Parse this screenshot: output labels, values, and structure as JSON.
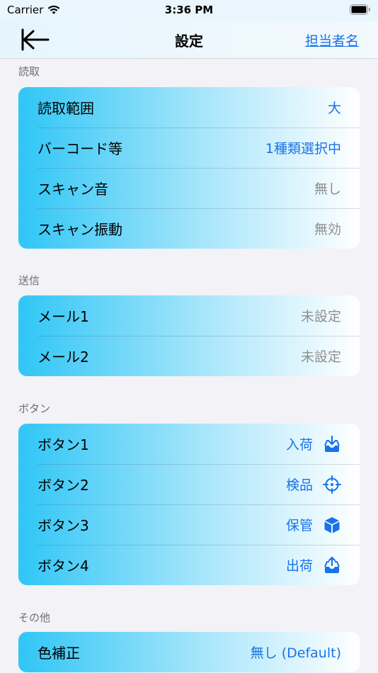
{
  "status_bar": {
    "carrier": "Carrier",
    "time": "3:36 PM"
  },
  "nav": {
    "title": "設定",
    "right_link": "担当者名"
  },
  "sections": [
    {
      "header": "読取",
      "rows": [
        {
          "label": "読取範囲",
          "value": "大"
        },
        {
          "label": "バーコード等",
          "value": "1種類選択中"
        },
        {
          "label": "スキャン音",
          "value": "無し"
        },
        {
          "label": "スキャン振動",
          "value": "無効"
        }
      ]
    },
    {
      "header": "送信",
      "rows": [
        {
          "label": "メール1",
          "value": "未設定"
        },
        {
          "label": "メール2",
          "value": "未設定"
        }
      ]
    },
    {
      "header": "ボタン",
      "rows": [
        {
          "label": "ボタン1",
          "value": "入荷",
          "icon": "tray-download-icon"
        },
        {
          "label": "ボタン2",
          "value": "検品",
          "icon": "crosshair-icon"
        },
        {
          "label": "ボタン3",
          "value": "保管",
          "icon": "box-icon"
        },
        {
          "label": "ボタン4",
          "value": "出荷",
          "icon": "tray-upload-icon"
        }
      ]
    },
    {
      "header": "その他",
      "rows": [
        {
          "label": "色補正",
          "value": "無し (Default)"
        }
      ]
    }
  ],
  "colors": {
    "accent": "#1a73e8",
    "secondary_text": "#8e8e93",
    "gradient_start": "#2fc6f6"
  }
}
